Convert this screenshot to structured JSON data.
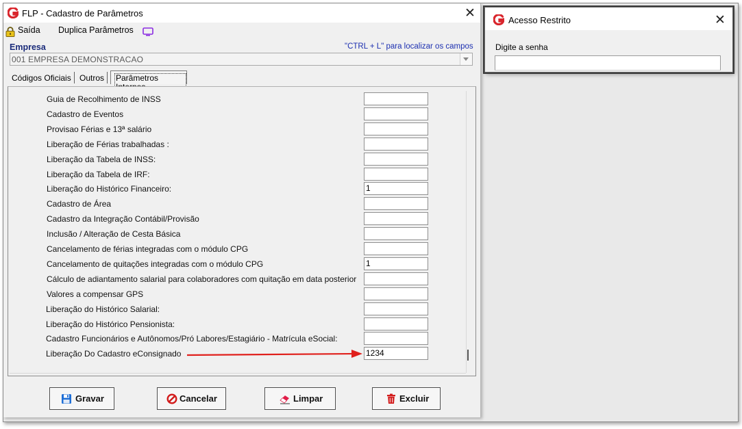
{
  "main_window": {
    "title": "FLP - Cadastro de Parâmetros",
    "close_glyph": "✕",
    "toolbar": {
      "saida_label": "Saída",
      "duplica_label": "Duplica Parâmetros"
    },
    "empresa": {
      "label": "Empresa",
      "hint": "\"CTRL + L\" para localizar os campos",
      "selected": "001 EMPRESA DEMONSTRACAO"
    },
    "tabs": [
      {
        "label": "Códigos Oficiais"
      },
      {
        "label": "Outros"
      },
      {
        "label": "Parâmetros Internos",
        "active": true
      }
    ],
    "parameters": [
      {
        "label": "Guia de Recolhimento de INSS",
        "value": ""
      },
      {
        "label": "Cadastro de Eventos",
        "value": ""
      },
      {
        "label": "Provisao Férias e 13ª salário",
        "value": ""
      },
      {
        "label": "Liberação de Férias trabalhadas :",
        "value": ""
      },
      {
        "label": "Liberação da Tabela de INSS:",
        "value": ""
      },
      {
        "label": "Liberação da Tabela de IRF:",
        "value": ""
      },
      {
        "label": "Liberação do Histórico Financeiro:",
        "value": "1"
      },
      {
        "label": "Cadastro de Área",
        "value": ""
      },
      {
        "label": "Cadastro da  Integração Contábil/Provisão",
        "value": ""
      },
      {
        "label": "Inclusão / Alteração de Cesta Básica",
        "value": ""
      },
      {
        "label": "Cancelamento de férias integradas com o módulo CPG",
        "value": ""
      },
      {
        "label": "Cancelamento de quitações integradas com o módulo CPG",
        "value": "1"
      },
      {
        "label": "Cálculo de adiantamento salarial para colaboradores com quitação em data posterior",
        "value": ""
      },
      {
        "label": "Valores a compensar GPS",
        "value": ""
      },
      {
        "label": "Liberação do Histórico Salarial:",
        "value": ""
      },
      {
        "label": "Liberação do Histórico Pensionista:",
        "value": ""
      },
      {
        "label": "Cadastro Funcionários e Autônomos/Pró Labores/Estagiário  - Matrícula eSocial:",
        "value": ""
      },
      {
        "label": "Liberação Do Cadastro eConsignado",
        "value": "1234"
      }
    ],
    "buttons": {
      "gravar": "Gravar",
      "cancelar": "Cancelar",
      "limpar": "Limpar",
      "excluir": "Excluir"
    }
  },
  "dialog": {
    "title": "Acesso Restrito",
    "close_glyph": "✕",
    "password_label": "Digite a senha",
    "password_value": ""
  },
  "icons": {
    "app_logo": "g-logo-icon",
    "saida": "lock-icon",
    "duplica": "monitor-icon",
    "gravar": "floppy-disk-icon",
    "cancelar": "no-entry-icon",
    "limpar": "eraser-icon",
    "excluir": "trash-icon"
  },
  "colors": {
    "logo_red": "#d9262d",
    "empresa_label": "#1a2b7a",
    "hint_blue": "#1c2fb0",
    "annotation_arrow": "#e0201c",
    "monitor_purple": "#8a2be2"
  }
}
